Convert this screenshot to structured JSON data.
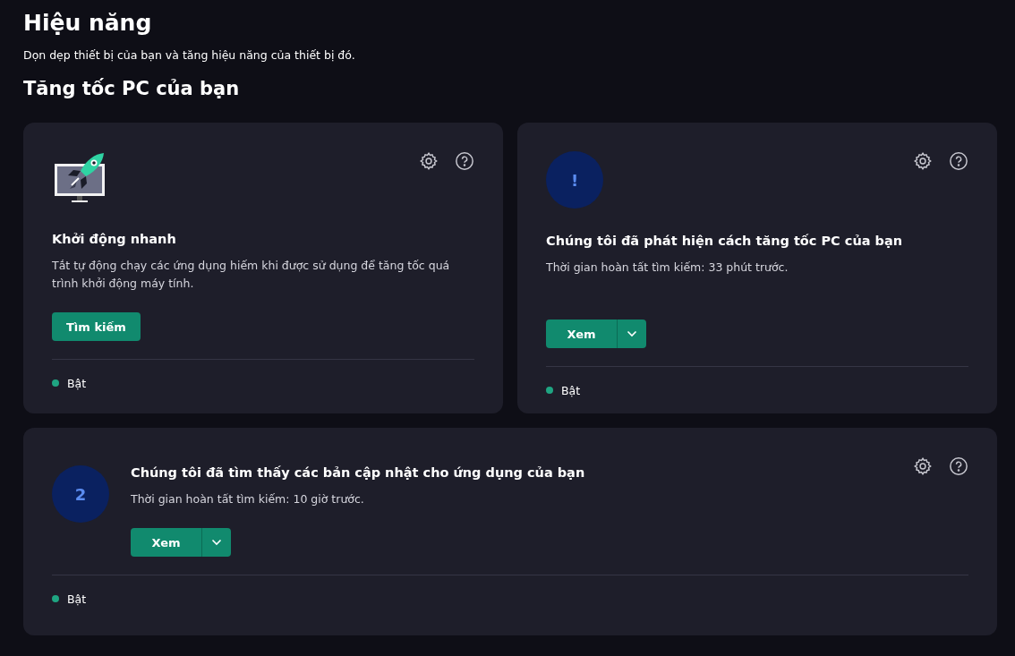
{
  "page": {
    "title": "Hiệu năng",
    "subtitle": "Dọn dẹp thiết bị của bạn và tăng hiệu năng của thiết bị đó.",
    "section_title": "Tăng tốc PC của bạn"
  },
  "cards": [
    {
      "kind": "tile",
      "icon": {
        "kind": "rocket"
      },
      "title": "Khởi động nhanh",
      "description": "Tắt tự động chạy các ứng dụng hiếm khi được sử dụng để tăng tốc quá trình khởi động máy tính.",
      "button": {
        "kind": "plain",
        "label": "Tìm kiếm"
      },
      "status": {
        "label": "Bật",
        "color": "#1fa582"
      }
    },
    {
      "kind": "tile",
      "icon": {
        "kind": "badge",
        "label": "!"
      },
      "title": "Chúng tôi đã phát hiện cách tăng tốc PC của bạn",
      "description": "Thời gian hoàn tất tìm kiếm: 33 phút trước.",
      "button": {
        "kind": "split",
        "label": "Xem"
      },
      "status": {
        "label": "Bật",
        "color": "#1fa582"
      }
    },
    {
      "kind": "wide",
      "icon": {
        "kind": "badge",
        "label": "2"
      },
      "title": "Chúng tôi đã tìm thấy các bản cập nhật cho ứng dụng của bạn",
      "description": "Thời gian hoàn tất tìm kiếm: 10 giờ trước.",
      "button": {
        "kind": "split",
        "label": "Xem"
      },
      "status": {
        "label": "Bật",
        "color": "#1fa582"
      }
    }
  ]
}
